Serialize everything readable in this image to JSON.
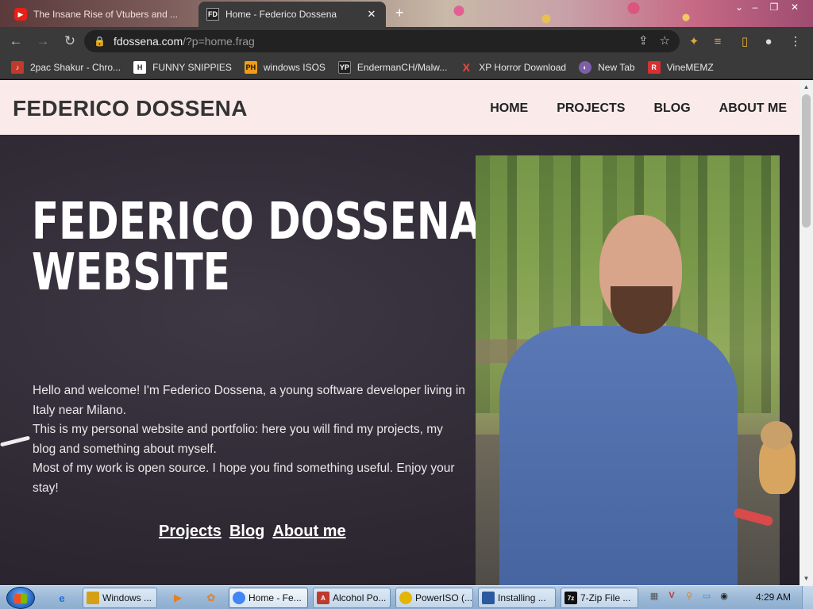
{
  "browser": {
    "tabs": [
      {
        "title": "The Insane Rise of Vtubers and ...",
        "favicon": "youtube-icon"
      },
      {
        "title": "Home - Federico Dossena",
        "favicon": "FD"
      }
    ],
    "new_tab_label": "+",
    "url_host": "fdossena.com",
    "url_path": "/?p=home.frag",
    "bookmarks": [
      {
        "label": "2pac Shakur - Chro...",
        "icon": "music-icon",
        "icon_text": "♪",
        "color": "#c0392b"
      },
      {
        "label": "FUNNY SNIPPIES",
        "icon": "h-icon",
        "icon_text": "H",
        "color": "#222"
      },
      {
        "label": "windows ISOS",
        "icon": "ph-icon",
        "icon_text": "PH",
        "color": "#f39c12"
      },
      {
        "label": "EndermanCH/Malw...",
        "icon": "yp-icon",
        "icon_text": "YP",
        "color": "#333"
      },
      {
        "label": "XP Horror Download",
        "icon": "x-icon",
        "icon_text": "X",
        "color": "#c0392b"
      },
      {
        "label": "New Tab",
        "icon": "globe-icon",
        "icon_text": "◐",
        "color": "#7d5fa8"
      },
      {
        "label": "VineMEMZ",
        "icon": "r-icon",
        "icon_text": "R",
        "color": "#d63031"
      }
    ]
  },
  "site": {
    "brand": "FEDERICO DOSSENA",
    "nav": [
      "HOME",
      "PROJECTS",
      "BLOG",
      "ABOUT ME"
    ],
    "hero_title_line1": "FEDERICO DOSSENA'S",
    "hero_title_line2": "WEBSITE",
    "hero_paragraphs": [
      "Hello and welcome! I'm Federico Dossena, a young software developer living in Italy near Milano.",
      "This is my personal website and portfolio: here you will find my projects, my blog and something about myself.",
      "Most of my work is open source. I hope you find something useful. Enjoy your stay!"
    ],
    "hero_links": [
      "Projects",
      "Blog",
      "About me"
    ]
  },
  "taskbar": {
    "buttons": [
      {
        "label": "Windows ...",
        "icon_color": "#d4a017",
        "active": false
      },
      {
        "label": "Home - Fe...",
        "icon_color": "#4285f4",
        "active": true
      },
      {
        "label": "Alcohol Po...",
        "icon_color": "#c0392b",
        "active": false
      },
      {
        "label": "PowerISO (...",
        "icon_color": "#e3b505",
        "active": false
      },
      {
        "label": "Installing ...",
        "icon_color": "#2c5aa0",
        "active": false
      },
      {
        "label": "7-Zip File ...",
        "icon_color": "#111",
        "active": false
      }
    ],
    "clock": "4:29 AM"
  }
}
